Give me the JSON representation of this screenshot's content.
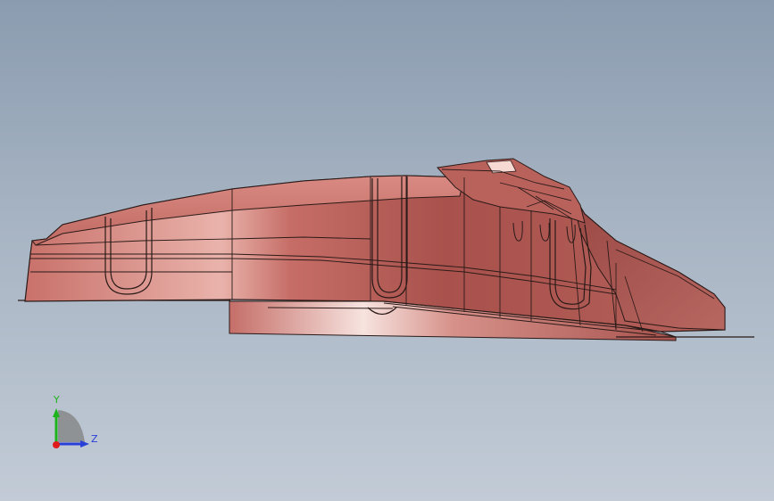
{
  "viewport": {
    "background_top": "#8b9cb0",
    "background_bottom": "#c2cbd6"
  },
  "model": {
    "fill_color": "#c06a63",
    "highlight_color": "#f4cfc9",
    "edge_color": "#2a1a18"
  },
  "triad": {
    "y_label": "Y",
    "z_label": "Z",
    "y_color": "#1db31d",
    "z_color": "#2a3ed8",
    "x_color": "#e01a1a",
    "icon": "coordinate-triad-icon"
  }
}
